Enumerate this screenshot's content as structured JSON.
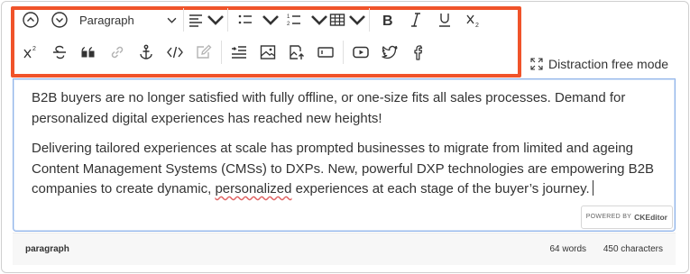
{
  "toolbar": {
    "heading_select": {
      "value": "Paragraph"
    },
    "row1": [
      {
        "name": "increase-indent-icon"
      },
      {
        "name": "decrease-indent-icon"
      },
      {
        "name": "alignment-icon"
      },
      {
        "name": "bulleted-list-icon"
      },
      {
        "name": "numbered-list-icon"
      },
      {
        "name": "insert-table-icon"
      },
      {
        "name": "bold-icon"
      },
      {
        "name": "italic-icon"
      },
      {
        "name": "underline-icon"
      },
      {
        "name": "subscript-icon"
      }
    ],
    "row2": [
      {
        "name": "superscript-icon"
      },
      {
        "name": "strikethrough-icon"
      },
      {
        "name": "block-quote-icon"
      },
      {
        "name": "link-icon",
        "disabled": true
      },
      {
        "name": "anchor-icon"
      },
      {
        "name": "code-icon"
      },
      {
        "name": "edit-icon",
        "disabled": true
      },
      {
        "name": "page-break-icon"
      },
      {
        "name": "insert-image-icon"
      },
      {
        "name": "upload-image-icon"
      },
      {
        "name": "text-field-icon"
      },
      {
        "name": "youtube-icon"
      },
      {
        "name": "twitter-icon"
      },
      {
        "name": "facebook-icon"
      }
    ],
    "highlight_color": "#f0532a"
  },
  "distraction_free": {
    "label": "Distraction free mode"
  },
  "editor": {
    "paragraphs": [
      "B2B buyers are no longer satisfied with fully offline, or one-size fits all sales processes. Demand for personalized digital experiences has reached new heights!",
      {
        "before": "Delivering tailored experiences at scale has prompted businesses to migrate from limited and ageing Content Management Systems (CMSs) to DXPs. New, powerful DXP technologies are empowering B2B companies to create dynamic, ",
        "misspelled": "personalized",
        "after": " experiences at each stage of the buyer’s journey."
      }
    ],
    "powered_by": "POWERED BY",
    "powered_brand": "CKEditor",
    "focus_border": "#8fb3e9"
  },
  "status_bar": {
    "path": "paragraph",
    "words": "64 words",
    "characters": "450 characters"
  }
}
